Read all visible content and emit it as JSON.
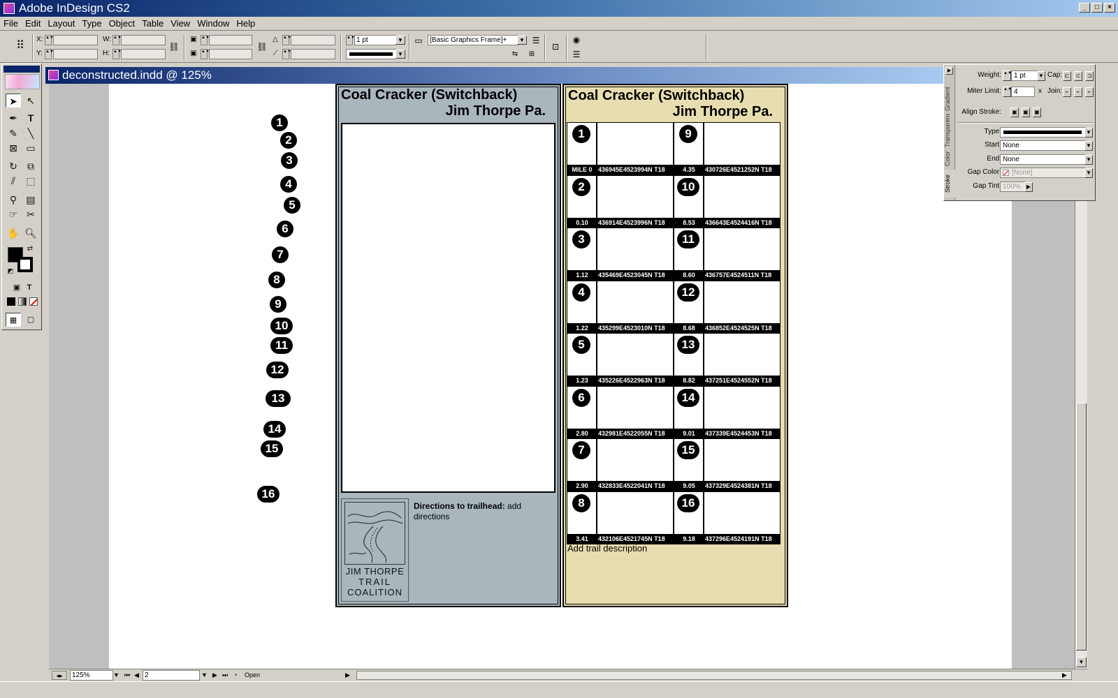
{
  "app": {
    "title": "Adobe InDesign CS2"
  },
  "menu": [
    "File",
    "Edit",
    "Layout",
    "Type",
    "Object",
    "Table",
    "View",
    "Window",
    "Help"
  ],
  "control": {
    "x_label": "X:",
    "y_label": "Y:",
    "w_label": "W:",
    "h_label": "H:",
    "stroke_weight": "1 pt",
    "object_style": "[Basic Graphics Frame]+"
  },
  "document": {
    "title": "deconstructed.indd @ 125%"
  },
  "status": {
    "zoom": "125%",
    "page": "2",
    "open_label": "Open"
  },
  "markers": [
    "1",
    "2",
    "3",
    "4",
    "5",
    "6",
    "7",
    "8",
    "9",
    "10",
    "11",
    "12",
    "13",
    "14",
    "15",
    "16"
  ],
  "left_card": {
    "title_line1": "Coal Cracker (Switchback)",
    "title_line2": "Jim Thorpe Pa.",
    "logo_line1": "JIM THORPE",
    "logo_line2": "TRAIL",
    "logo_line3": "COALITION",
    "directions_bold": "Directions to trailhead:",
    "directions_text": "add directions"
  },
  "right_card": {
    "title_line1": "Coal Cracker (Switchback)",
    "title_line2": "Jim Thorpe Pa.",
    "trail_description": "Add trail description",
    "waypoints_left": [
      {
        "num": "1",
        "mile": "MILE 0",
        "coord": "436945E4523994N T18"
      },
      {
        "num": "2",
        "mile": "0.10",
        "coord": "436914E4523996N T18"
      },
      {
        "num": "3",
        "mile": "1.12",
        "coord": "435469E4523045N T18"
      },
      {
        "num": "4",
        "mile": "1.22",
        "coord": "435299E4523010N T18"
      },
      {
        "num": "5",
        "mile": "1.23",
        "coord": "435226E4522963N T18"
      },
      {
        "num": "6",
        "mile": "2.80",
        "coord": "432981E4522055N T18"
      },
      {
        "num": "7",
        "mile": "2.90",
        "coord": "432833E4522041N T18"
      },
      {
        "num": "8",
        "mile": "3.41",
        "coord": "432106E4521745N T18"
      }
    ],
    "waypoints_right": [
      {
        "num": "9",
        "mile": "4.35",
        "coord": "430726E4521252N T18"
      },
      {
        "num": "10",
        "mile": "8.53",
        "coord": "436643E4524416N T18"
      },
      {
        "num": "11",
        "mile": "8.60",
        "coord": "436757E4524511N T18"
      },
      {
        "num": "12",
        "mile": "8.68",
        "coord": "436852E4524525N T18"
      },
      {
        "num": "13",
        "mile": "8.82",
        "coord": "437251E4524552N T18"
      },
      {
        "num": "14",
        "mile": "9.01",
        "coord": "437339E4524453N T18"
      },
      {
        "num": "15",
        "mile": "9.05",
        "coord": "437329E4524381N T18"
      },
      {
        "num": "16",
        "mile": "9.18",
        "coord": "437296E4524191N T18"
      }
    ]
  },
  "stroke_panel": {
    "tabs": [
      "Stroke",
      "Color",
      "Transparency",
      "Gradient"
    ],
    "weight_label": "Weight:",
    "weight_value": "1 pt",
    "cap_label": "Cap:",
    "miter_label": "Miter Limit:",
    "miter_value": "4",
    "miter_x": "x",
    "join_label": "Join:",
    "align_label": "Align Stroke:",
    "type_label": "Type:",
    "start_label": "Start:",
    "start_value": "None",
    "end_label": "End:",
    "end_value": "None",
    "gap_color_label": "Gap Color:",
    "gap_color_value": "[None]",
    "gap_tint_label": "Gap Tint:",
    "gap_tint_value": "100%"
  }
}
